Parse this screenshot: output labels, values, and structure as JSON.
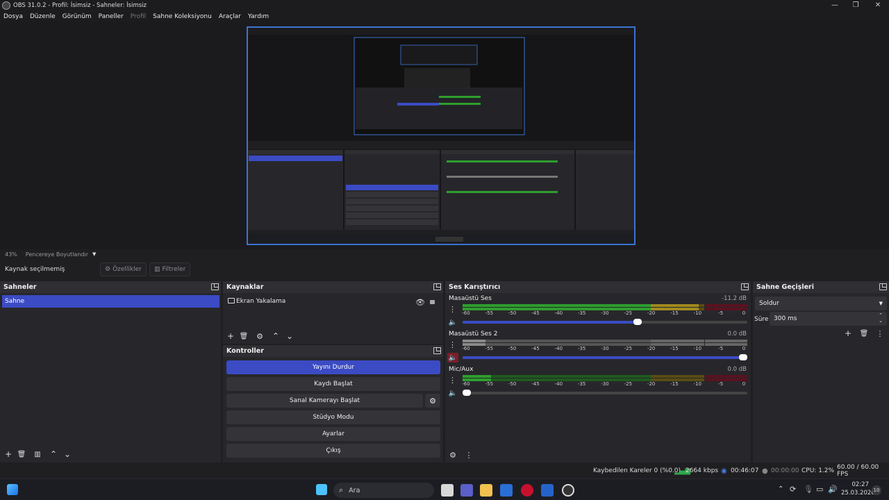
{
  "window": {
    "title": "OBS 31.0.2 - Profil: İsimsiz - Sahneler: İsimsiz",
    "minimize": "—",
    "maximize": "❐",
    "close": "✕"
  },
  "menu": [
    {
      "label": "Dosya",
      "enabled": true
    },
    {
      "label": "Düzenle",
      "enabled": true
    },
    {
      "label": "Görünüm",
      "enabled": true
    },
    {
      "label": "Paneller",
      "enabled": true
    },
    {
      "label": "Profil",
      "enabled": false
    },
    {
      "label": "Sahne Koleksiyonu",
      "enabled": true
    },
    {
      "label": "Araçlar",
      "enabled": true
    },
    {
      "label": "Yardım",
      "enabled": true
    }
  ],
  "preview_bar": {
    "zoom": "43%",
    "fit_label": "Pencereye Boyutlandır"
  },
  "source_toolbar": {
    "no_selection": "Kaynak seçilmemiş",
    "properties": "Özellikler",
    "filters": "Filtreler"
  },
  "scenes": {
    "title": "Sahneler",
    "items": [
      "Sahne"
    ]
  },
  "sources": {
    "title": "Kaynaklar",
    "items": [
      {
        "name": "Ekran Yakalama",
        "visible": true,
        "locked": true
      }
    ]
  },
  "controls": {
    "title": "Kontroller",
    "stop_stream": "Yayını Durdur",
    "start_record": "Kaydı Başlat",
    "start_virtualcam": "Sanal Kamerayı Başlat",
    "studio_mode": "Stüdyo Modu",
    "settings": "Ayarlar",
    "exit": "Çıkış"
  },
  "mixer": {
    "title": "Ses Karıştırıcı",
    "ticks": [
      "-60",
      "-55",
      "-50",
      "-45",
      "-40",
      "-35",
      "-30",
      "-25",
      "-20",
      "-15",
      "-10",
      "-5",
      "0"
    ],
    "channels": [
      {
        "name": "Masaüstü Ses",
        "db": "-11.2 dB",
        "muted": false,
        "volume": 0.62,
        "level": 0.83
      },
      {
        "name": "Masaüstü Ses 2",
        "db": "0.0 dB",
        "muted": true,
        "volume": 1.0,
        "level": 0.08
      },
      {
        "name": "Mic/Aux",
        "db": "0.0 dB",
        "muted": false,
        "volume": 0.0,
        "level": 0.1
      }
    ]
  },
  "transitions": {
    "title": "Sahne Geçişleri",
    "selected": "Soldur",
    "duration_label": "Süre",
    "duration_value": "300 ms"
  },
  "status": {
    "dropped": "Kaybedilen Kareler 0 (%0.0)",
    "bitrate": "2664 kbps",
    "stream_time": "00:46:07",
    "rec_time": "00:00:00",
    "cpu": "CPU: 1.2%",
    "fps": "60.00 / 60.00 FPS"
  },
  "taskbar": {
    "search_label": "Ara",
    "time": "02:27",
    "date": "25.03.2026",
    "notif": "10"
  },
  "colors": {
    "accent": "#3b4bc4",
    "selection_border": "#3b73d1",
    "meter_green": "#2e9e2e",
    "meter_yellow": "#a08a1e",
    "meter_red": "#a02030"
  }
}
